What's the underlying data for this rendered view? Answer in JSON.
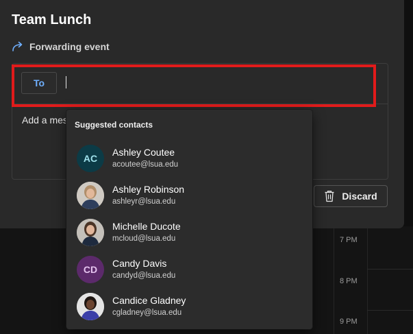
{
  "event": {
    "title": "Team Lunch",
    "mode_label": "Forwarding event"
  },
  "compose": {
    "to_label": "To",
    "to_value": "",
    "message_placeholder": "Add a mes"
  },
  "actions": {
    "discard_label": "Discard"
  },
  "suggestions": {
    "header": "Suggested contacts",
    "contacts": [
      {
        "name": "Ashley Coutee",
        "email": "acoutee@lsua.edu",
        "initials": "AC",
        "avatar_color": "#0c3b46",
        "initials_color": "#9ee0ea"
      },
      {
        "name": "Ashley Robinson",
        "email": "ashleyr@lsua.edu",
        "initials": "",
        "avatar_color": "#c7c4c0"
      },
      {
        "name": "Michelle Ducote",
        "email": "mcloud@lsua.edu",
        "initials": "",
        "avatar_color": "#bcb8b2"
      },
      {
        "name": "Candy Davis",
        "email": "candyd@lsua.edu",
        "initials": "CD",
        "avatar_color": "#5c2a6b",
        "initials_color": "#e6c4f0"
      },
      {
        "name": "Candice Gladney",
        "email": "cgladney@lsua.edu",
        "initials": "",
        "avatar_color": "#d8d8d8"
      }
    ]
  },
  "calendar": {
    "times": [
      "7 PM",
      "8 PM",
      "9 PM"
    ]
  },
  "colors": {
    "highlight": "#e11b1b",
    "accent": "#6fb0ff",
    "panel": "#292929"
  }
}
